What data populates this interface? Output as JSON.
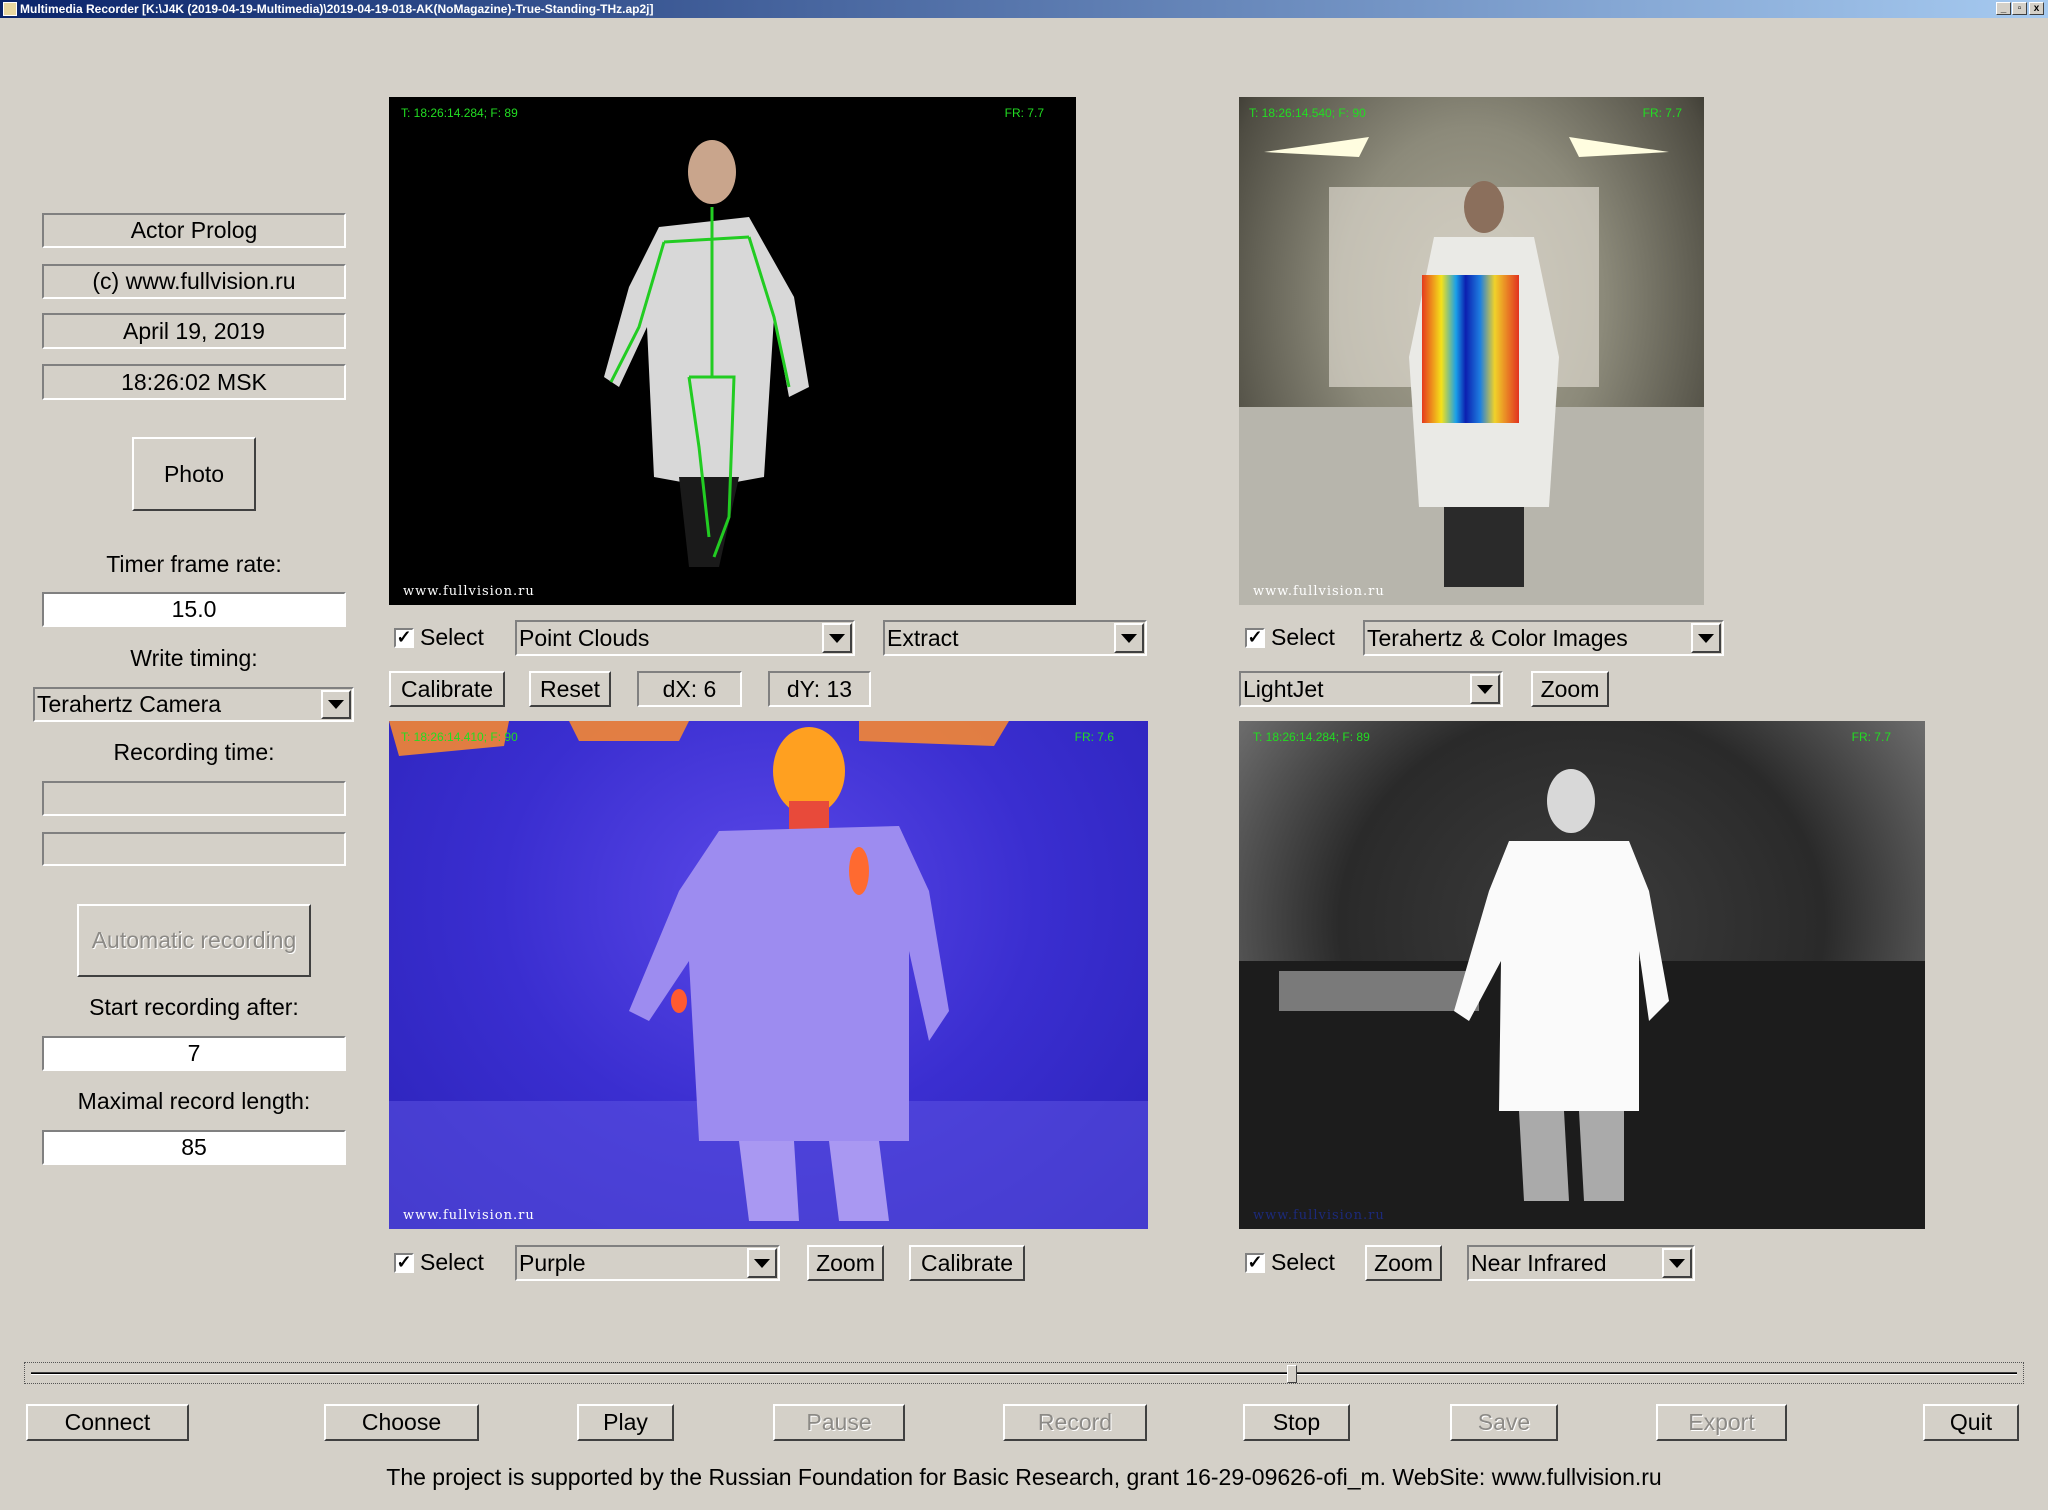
{
  "window": {
    "title": "Multimedia Recorder [K:\\J4K (2019-04-19-Multimedia)\\2019-04-19-018-AK(NoMagazine)-True-Standing-THz.ap2j]",
    "minimize": "_",
    "maximize": "▫",
    "close": "x"
  },
  "sidebar": {
    "info": [
      "Actor Prolog",
      "(c) www.fullvision.ru",
      "April 19, 2019",
      "18:26:02 MSK"
    ],
    "photo_button": "Photo",
    "timer_frame_rate_label": "Timer frame rate:",
    "timer_frame_rate_value": "15.0",
    "write_timing_label": "Write timing:",
    "write_timing_value": "Terahertz Camera",
    "recording_time_label": "Recording time:",
    "recording_time_1": "",
    "recording_time_2": "",
    "automatic_recording_button": "Automatic recording",
    "start_after_label": "Start recording after:",
    "start_after_value": "7",
    "max_length_label": "Maximal record length:",
    "max_length_value": "85"
  },
  "views": {
    "point_clouds": {
      "time": "T: 18:26:14.284; F: 89",
      "fr": "FR: 7.7",
      "watermark": "www.fullvision.ru",
      "select_label": "Select",
      "selected": true,
      "mode": "Point Clouds",
      "filter": "Extract",
      "calibrate": "Calibrate",
      "reset": "Reset",
      "dx": "dX: 6",
      "dy": "dY: 13"
    },
    "terahertz": {
      "time": "T: 18:26:14.540; F: 90",
      "fr": "FR: 7.7",
      "watermark": "www.fullvision.ru",
      "select_label": "Select",
      "selected": true,
      "mode": "Terahertz & Color Images",
      "palette": "LightJet",
      "zoom": "Zoom"
    },
    "thermal": {
      "time": "T: 18:26:14.410; F: 90",
      "fr": "FR: 7.6",
      "watermark": "www.fullvision.ru",
      "select_label": "Select",
      "selected": true,
      "palette": "Purple",
      "zoom": "Zoom",
      "calibrate": "Calibrate"
    },
    "infrared": {
      "time": "T: 18:26:14.284; F: 89",
      "fr": "FR: 7.7",
      "watermark": "www.fullvision.ru",
      "select_label": "Select",
      "selected": true,
      "zoom": "Zoom",
      "mode": "Near Infrared"
    }
  },
  "playback": {
    "position": 0.635
  },
  "buttons": {
    "connect": "Connect",
    "choose": "Choose",
    "play": "Play",
    "pause": "Pause",
    "record": "Record",
    "stop": "Stop",
    "save": "Save",
    "export": "Export",
    "quit": "Quit"
  },
  "footer": "The project is supported by the Russian Foundation for Basic Research, grant 16-29-09626-ofi_m. WebSite: www.fullvision.ru"
}
